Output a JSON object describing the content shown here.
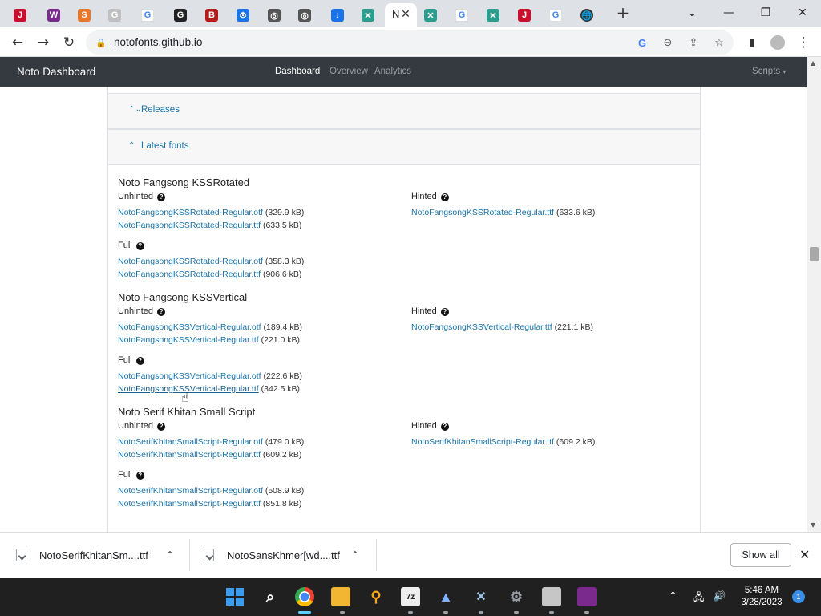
{
  "browser": {
    "active_tab_initial": "N",
    "url": "notofonts.github.io",
    "tab_favicons": [
      "J",
      "W",
      "S",
      "G",
      "G",
      "G",
      "B",
      "⚙",
      "◎",
      "◎",
      "↓",
      "✕",
      "N",
      "✕",
      "G",
      "✕",
      "J",
      "G",
      "🌐"
    ],
    "new_tab": "+",
    "window_controls": [
      "⌄",
      "—",
      "❐",
      "✕"
    ]
  },
  "appnav": {
    "brand": "Noto Dashboard",
    "links": [
      "Dashboard",
      "Overview",
      "Analytics"
    ],
    "scripts_menu": "Scripts"
  },
  "sections": {
    "releases": "Releases",
    "latest_fonts": "Latest fonts"
  },
  "fonts": [
    {
      "name": "Noto Fangsong KSSRotated",
      "unhinted_label": "Unhinted",
      "unhinted": [
        {
          "file": "NotoFangsongKSSRotated-Regular.otf",
          "size": "(329.9 kB)"
        },
        {
          "file": "NotoFangsongKSSRotated-Regular.ttf",
          "size": "(633.5 kB)"
        }
      ],
      "hinted_label": "Hinted",
      "hinted": [
        {
          "file": "NotoFangsongKSSRotated-Regular.ttf",
          "size": "(633.6 kB)"
        }
      ],
      "full_label": "Full",
      "full": [
        {
          "file": "NotoFangsongKSSRotated-Regular.otf",
          "size": "(358.3 kB)"
        },
        {
          "file": "NotoFangsongKSSRotated-Regular.ttf",
          "size": "(906.6 kB)"
        }
      ]
    },
    {
      "name": "Noto Fangsong KSSVertical",
      "unhinted_label": "Unhinted",
      "unhinted": [
        {
          "file": "NotoFangsongKSSVertical-Regular.otf",
          "size": "(189.4 kB)"
        },
        {
          "file": "NotoFangsongKSSVertical-Regular.ttf",
          "size": "(221.0 kB)"
        }
      ],
      "hinted_label": "Hinted",
      "hinted": [
        {
          "file": "NotoFangsongKSSVertical-Regular.ttf",
          "size": "(221.1 kB)"
        }
      ],
      "full_label": "Full",
      "full": [
        {
          "file": "NotoFangsongKSSVertical-Regular.otf",
          "size": "(222.6 kB)"
        },
        {
          "file": "NotoFangsongKSSVertical-Regular.ttf",
          "size": "(342.5 kB)"
        }
      ]
    },
    {
      "name": "Noto Serif Khitan Small Script",
      "unhinted_label": "Unhinted",
      "unhinted": [
        {
          "file": "NotoSerifKhitanSmallScript-Regular.otf",
          "size": "(479.0 kB)"
        },
        {
          "file": "NotoSerifKhitanSmallScript-Regular.ttf",
          "size": "(609.2 kB)"
        }
      ],
      "hinted_label": "Hinted",
      "hinted": [
        {
          "file": "NotoSerifKhitanSmallScript-Regular.ttf",
          "size": "(609.2 kB)"
        }
      ],
      "full_label": "Full",
      "full": [
        {
          "file": "NotoSerifKhitanSmallScript-Regular.otf",
          "size": "(508.9 kB)"
        },
        {
          "file": "NotoSerifKhitanSmallScript-Regular.ttf",
          "size": "(851.8 kB)"
        }
      ]
    }
  ],
  "downloads": {
    "items": [
      "NotoSerifKhitanSm....ttf",
      "NotoSansKhmer[wd....ttf"
    ],
    "show_all": "Show all"
  },
  "taskbar": {
    "time": "5:46 AM",
    "date": "3/28/2023",
    "notifications": "1",
    "app_glyphs": [
      "7z"
    ]
  },
  "colors": {
    "link": "#1a73a8",
    "navbar": "#343a40",
    "taskbar": "#202020"
  }
}
